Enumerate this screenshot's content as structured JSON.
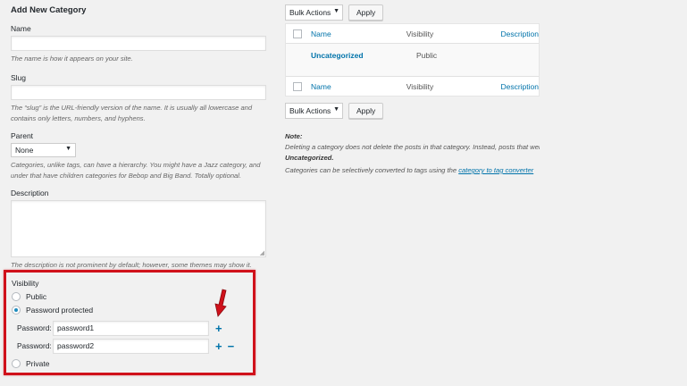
{
  "form": {
    "heading": "Add New Category",
    "name_label": "Name",
    "name_help": "The name is how it appears on your site.",
    "slug_label": "Slug",
    "slug_help": "The “slug” is the URL-friendly version of the name. It is usually all lowercase and contains only letters, numbers, and hyphens.",
    "parent_label": "Parent",
    "parent_value": "None",
    "parent_help": "Categories, unlike tags, can have a hierarchy. You might have a Jazz category, and under that have children categories for Bebop and Big Band. Totally optional.",
    "description_label": "Description",
    "description_help": "The description is not prominent by default; however, some themes may show it."
  },
  "visibility": {
    "label": "Visibility",
    "option_public": "Public",
    "option_password": "Password protected",
    "option_private": "Private",
    "selected": "Password protected",
    "password_label": "Password:",
    "passwords": [
      "password1",
      "password2"
    ],
    "add_symbol": "+",
    "remove_symbol": "−",
    "highlight_color": "#d0111b"
  },
  "list": {
    "bulk_actions": "Bulk Actions",
    "apply": "Apply",
    "columns": {
      "name": "Name",
      "visibility": "Visibility",
      "description": "Description"
    },
    "rows": [
      {
        "name": "Uncategorized",
        "visibility": "Public"
      }
    ]
  },
  "note": {
    "label": "Note:",
    "line1": "Deleting a category does not delete the posts in that category. Instead, posts that were only assigned to the deleted category are set to the category",
    "default_category": "Uncategorized",
    "line2_prefix": "Categories can be selectively converted to tags using the",
    "converter_link": "category to tag converter"
  },
  "colors": {
    "link": "#0073aa",
    "background": "#f1f1f1"
  }
}
